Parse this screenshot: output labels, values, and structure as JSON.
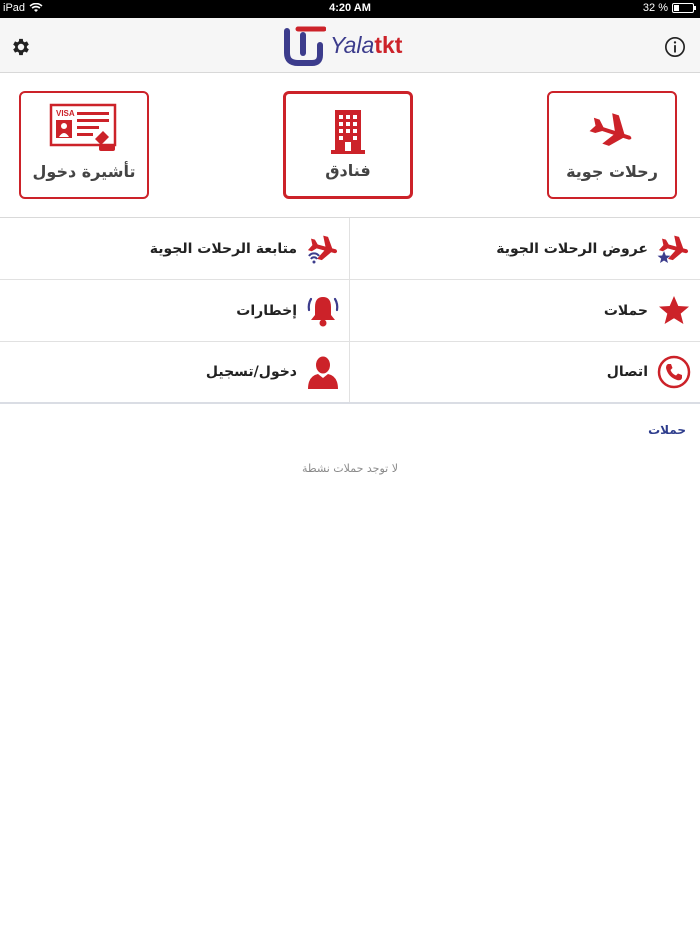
{
  "status_bar": {
    "device": "iPad",
    "time": "4:20 AM",
    "battery": "32 %"
  },
  "header": {
    "logo_brand_part1": "Yala",
    "logo_brand_part2": "tkt"
  },
  "tiles": [
    {
      "id": "visa",
      "label": "تأشيرة دخول",
      "icon": "visa-icon"
    },
    {
      "id": "hotels",
      "label": "فنادق",
      "icon": "building-icon"
    },
    {
      "id": "flights",
      "label": "رحلات جوية",
      "icon": "airplane-icon"
    }
  ],
  "menu": {
    "flight_tracking": "متابعة الرحلات الجوية",
    "flight_offers": "عروض الرحلات الجوية",
    "alerts": "إخطارات",
    "campaigns": "حملات",
    "login": "دخول/تسجيل",
    "contact": "اتصال"
  },
  "campaigns_section": {
    "title": "حملات",
    "empty_message": "لا توجد حملات نشطة"
  },
  "colors": {
    "brand_red": "#cc2229",
    "brand_blue": "#3c3c8c"
  },
  "icons": [
    "gear-icon",
    "info-icon",
    "wifi-icon",
    "airplane-icon",
    "building-icon",
    "visa-icon",
    "bell-icon",
    "star-icon",
    "user-icon",
    "phone-icon"
  ]
}
